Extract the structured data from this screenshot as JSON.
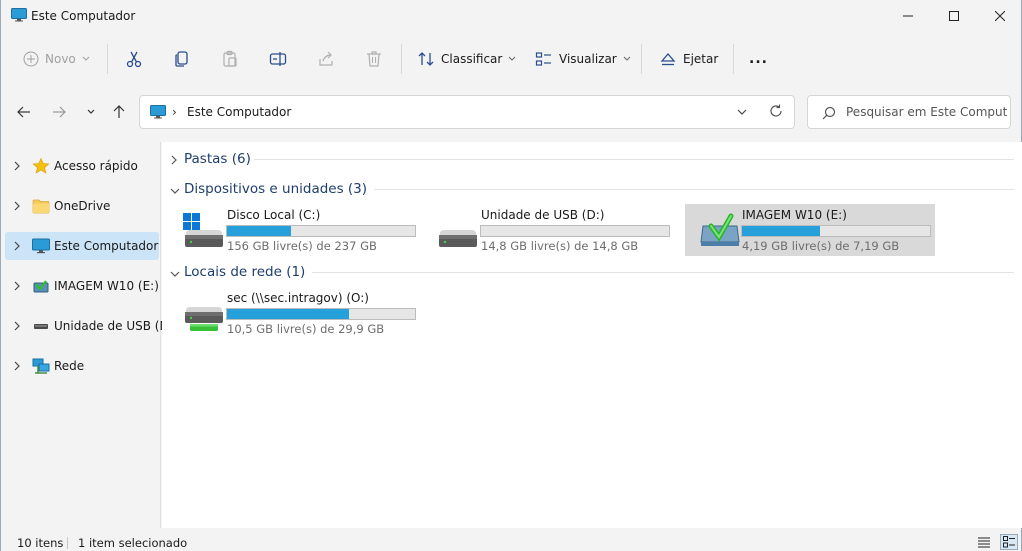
{
  "window": {
    "title": "Este Computador"
  },
  "toolbar": {
    "new_label": "Novo",
    "sort_label": "Classificar",
    "view_label": "Visualizar",
    "eject_label": "Ejetar",
    "more_label": "..."
  },
  "address": {
    "crumb": "Este Computador",
    "separator": "›"
  },
  "search": {
    "placeholder": "Pesquisar em Este Computa..."
  },
  "sidebar": {
    "items": [
      {
        "label": "Acesso rápido",
        "icon": "star-icon"
      },
      {
        "label": "OneDrive",
        "icon": "folder-icon"
      },
      {
        "label": "Este Computador",
        "icon": "computer-icon",
        "selected": true
      },
      {
        "label": "IMAGEM W10 (E:)",
        "icon": "image-drive-icon"
      },
      {
        "label": "Unidade de USB (D:)",
        "icon": "usb-drive-icon"
      },
      {
        "label": "Rede",
        "icon": "network-icon"
      }
    ]
  },
  "groups": {
    "folders": {
      "label": "Pastas (6)"
    },
    "devices": {
      "label": "Dispositivos e unidades (3)"
    },
    "network": {
      "label": "Locais de rede (1)"
    }
  },
  "drives": [
    {
      "name": "Disco Local (C:)",
      "free": "156 GB livre(s) de 237 GB",
      "used_fraction": 0.342,
      "icon": "windows-drive-icon"
    },
    {
      "name": "Unidade de USB (D:)",
      "free": "14,8 GB livre(s) de 14,8 GB",
      "used_fraction": 0.0,
      "icon": "usb-drive-icon"
    },
    {
      "name": "IMAGEM W10 (E:)",
      "free": "4,19 GB livre(s) de 7,19 GB",
      "used_fraction": 0.417,
      "icon": "image-drive-icon",
      "selected": true
    }
  ],
  "network_drives": [
    {
      "name": "sec (\\\\sec.intragov) (O:)",
      "free": "10,5 GB livre(s) de 29,9 GB",
      "used_fraction": 0.649,
      "icon": "network-drive-icon"
    }
  ],
  "status": {
    "items": "10 itens",
    "selected": "1 item selecionado"
  },
  "colors": {
    "accent": "#26a0da",
    "selection": "#cce4f7",
    "group_header": "#1e3e6e"
  }
}
